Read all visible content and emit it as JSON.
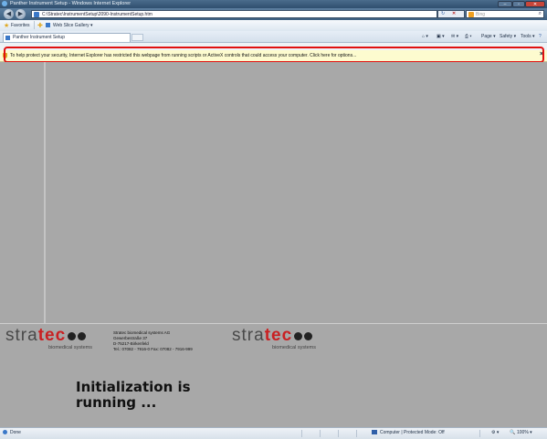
{
  "window": {
    "title": "Panther Instrument Setup - Windows Internet Explorer",
    "controls": {
      "minimize": "–",
      "maximize": "▫",
      "close": "✕"
    }
  },
  "nav": {
    "back_icon": "back-arrow-icon",
    "forward_icon": "forward-arrow-icon",
    "address": "C:\\Stratec\\InstrumentSetup\\2090-InstrumentSetup.htm",
    "search_placeholder": "Bing"
  },
  "favorites_bar": {
    "favorites_label": "Favorites",
    "web_slice_label": "Web Slice Gallery ▾"
  },
  "tabs": {
    "active_tab": "Panther Instrument Setup"
  },
  "command_bar": {
    "page": "Page ▾",
    "safety": "Safety ▾",
    "tools": "Tools ▾"
  },
  "info_bar": {
    "message": "To help protect your security, Internet Explorer has restricted this webpage from running scripts or ActiveX controls that could access your computer. Click here for options...",
    "close": "×"
  },
  "page": {
    "logo_left": {
      "stra": "stra",
      "tec": "tec",
      "sub": "biomedical systems"
    },
    "logo_right": {
      "stra": "stra",
      "tec": "tec",
      "sub": "biomedical systems"
    },
    "company_address": {
      "line1": "Stratec biomedical systems AG",
      "line2": "Gewerbestraße 37",
      "line3": "D-75217-Birkenfeld",
      "line4": "Tel.: 07082 - 7916-0 Fax: 07082 - 7916-999"
    },
    "status_line1": "Initialization is",
    "status_line2": "running ..."
  },
  "status_bar": {
    "left": "Done",
    "zone": "Computer | Protected Mode: Off",
    "zoom": "100% ▾"
  },
  "colors": {
    "content_bg": "#a8a8a8",
    "brand_red": "#c92022",
    "highlight_frame": "#e01010",
    "info_bar_bg": "#fdfbcf"
  }
}
